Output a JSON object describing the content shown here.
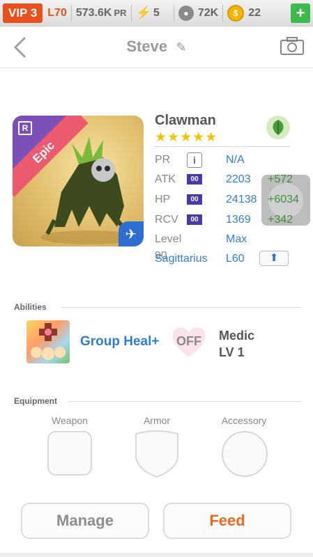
{
  "status_bar": {
    "vip": "VIP 3",
    "level": "L70",
    "pr": "573.6K",
    "pr_suffix": "PR",
    "energy": "5",
    "food": "72K",
    "coins": "22"
  },
  "header": {
    "title": "Steve"
  },
  "monster": {
    "name": "Clawman",
    "rarity": "Epic",
    "rank": "R",
    "stars": "★★★★★",
    "element": "nature",
    "stats": [
      {
        "label": "PR",
        "value": "N/A",
        "plus": ""
      },
      {
        "label": "ATK",
        "value": "2203",
        "plus": "+572"
      },
      {
        "label": "HP",
        "value": "24138",
        "plus": "+6034"
      },
      {
        "label": "RCV",
        "value": "1369",
        "plus": "+342"
      },
      {
        "label": "Level 90",
        "value": "Max",
        "plus": ""
      },
      {
        "label": "Sagittarius",
        "value": "L60",
        "plus": ""
      }
    ],
    "lv_box": "00"
  },
  "abilities": {
    "section_label": "Abilities",
    "name": "Group Heal+",
    "toggle": "OFF",
    "class_name": "Medic",
    "class_level": "LV 1"
  },
  "equipment": {
    "section_label": "Equipment",
    "slots": [
      "Weapon",
      "Armor",
      "Accessory"
    ]
  },
  "actions": {
    "manage": "Manage",
    "feed": "Feed"
  },
  "colors": {
    "accent_orange": "#e8501c",
    "link_blue": "#2f7fd1",
    "bonus_green": "#3e8e3e",
    "epic_pink": "#ec5a6e"
  }
}
